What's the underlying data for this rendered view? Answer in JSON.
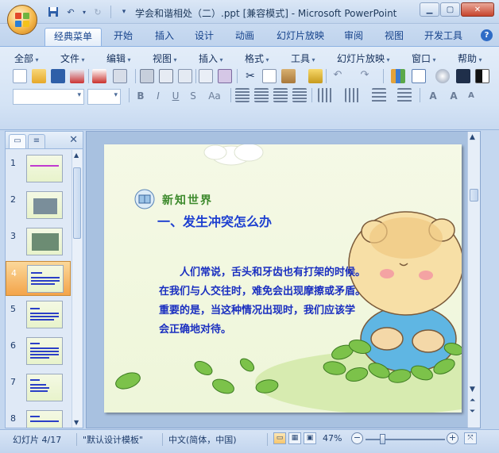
{
  "window": {
    "title": "学会和谐相处（二）.ppt [兼容模式] - Microsoft PowerPoint",
    "minimize_icon": "minimize-icon",
    "maximize_icon": "maximize-icon",
    "close_icon": "close-icon"
  },
  "ribbon_tabs": [
    "经典菜单",
    "开始",
    "插入",
    "设计",
    "动画",
    "幻灯片放映",
    "审阅",
    "视图",
    "开发工具"
  ],
  "active_tab": "经典菜单",
  "classic_menu": [
    "全部",
    "文件",
    "编辑",
    "视图",
    "插入",
    "格式",
    "工具",
    "幻灯片放映",
    "窗口",
    "帮助"
  ],
  "format_bar": {
    "bold": "B",
    "italic": "I",
    "underline": "U",
    "strike": "S",
    "change_case": "Aa"
  },
  "thumbnails": {
    "numbers": [
      "1",
      "2",
      "3",
      "4",
      "5",
      "6",
      "7",
      "8"
    ],
    "selected": "4"
  },
  "slide": {
    "subhead": "新知世界",
    "heading": "一、发生冲突怎么办",
    "body_lines": [
      "　　人们常说，舌头和牙齿也有打架的时候。",
      "在我们与人交往时，难免会出现摩擦或矛盾。",
      "重要的是，当这种情况出现时，我们应该学",
      "会正确地对待。"
    ]
  },
  "status": {
    "slide_info": "幻灯片 4/17",
    "theme": "\"默认设计模板\"",
    "language": "中文(简体，中国)",
    "zoom": "47%"
  },
  "colors": {
    "slide_heading": "#1d3fd0",
    "slide_subhead": "#3d8a2c",
    "selection": "#f3a44a"
  }
}
